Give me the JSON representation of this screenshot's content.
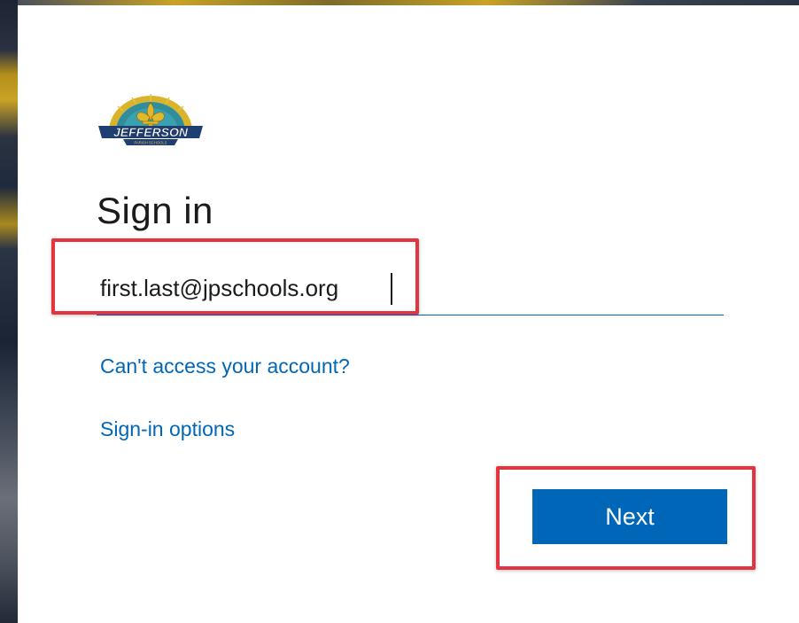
{
  "brand": {
    "logo_text": "JEFFERSON",
    "logo_subtext": "PARISH SCHOOLS",
    "icon": "fleur-de-lis-icon",
    "colors": {
      "navy": "#1f3f73",
      "gold": "#c9a325",
      "teal": "#2a8c9a"
    }
  },
  "signin": {
    "title": "Sign in",
    "email_value": "first.last@jpschools.org",
    "cant_access_link": "Can't access your account?",
    "signin_options_link": "Sign-in options",
    "next_button": "Next"
  },
  "colors": {
    "accent": "#0067b8",
    "highlight": "#e2353f"
  }
}
